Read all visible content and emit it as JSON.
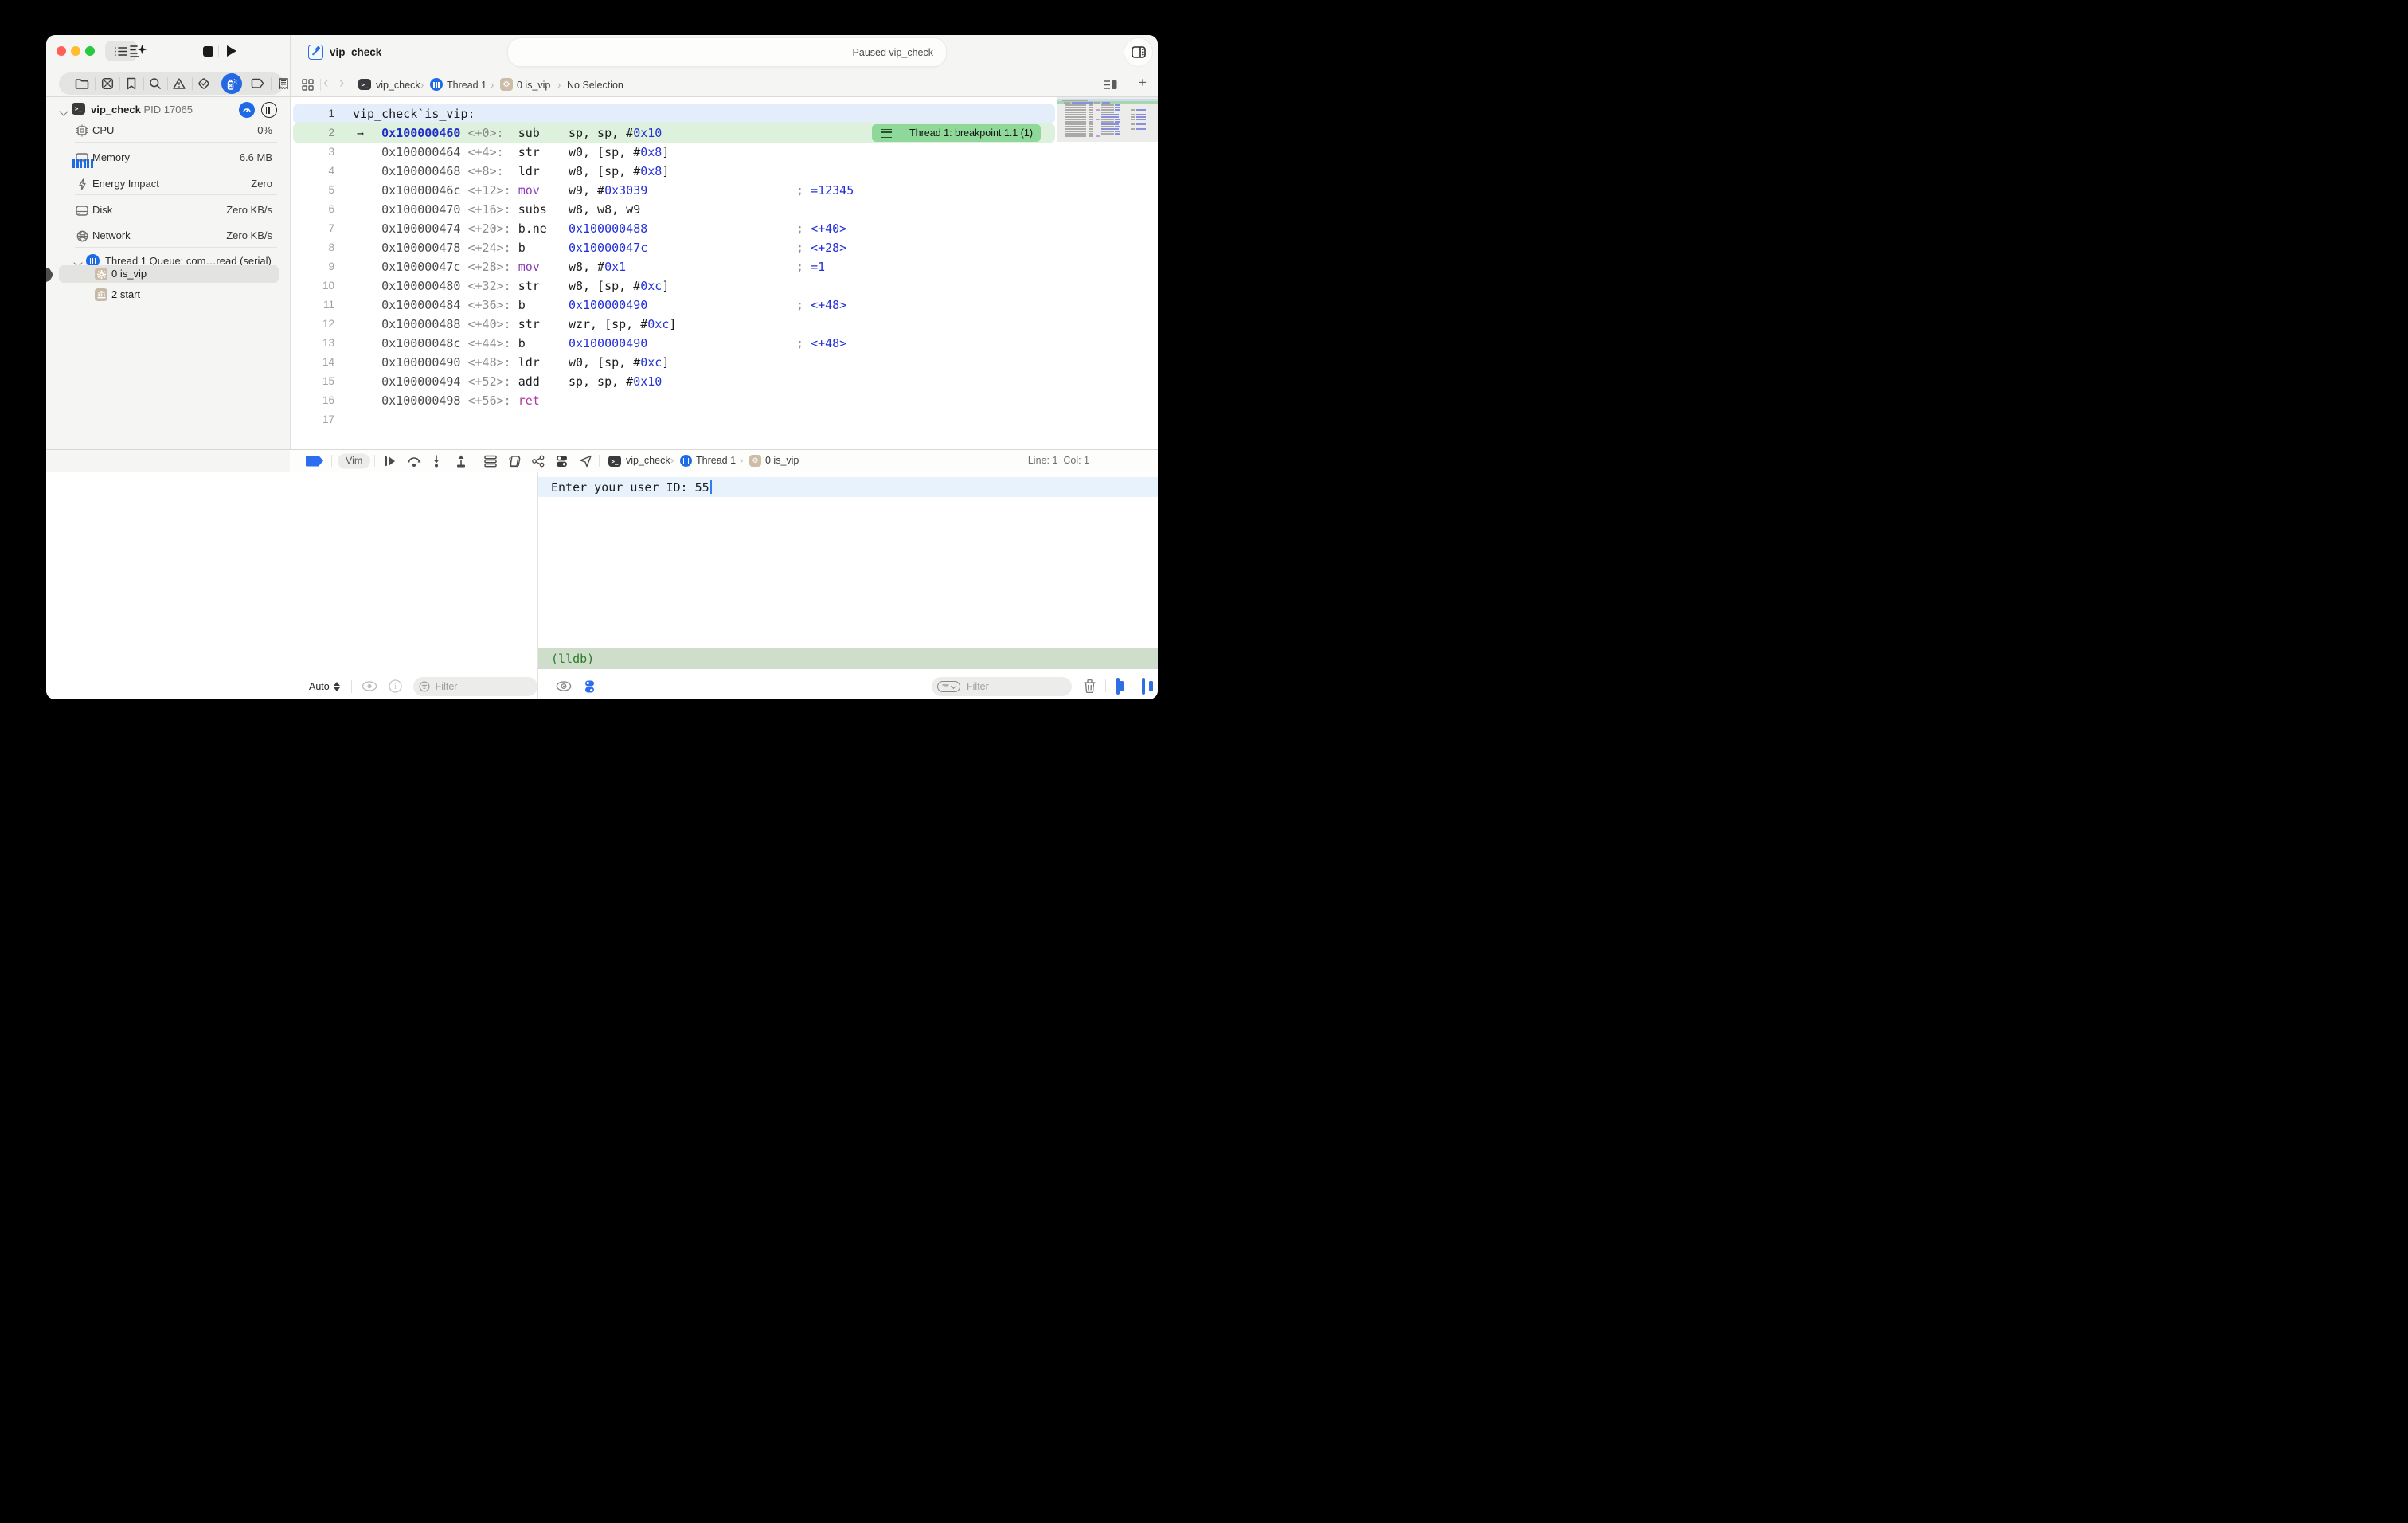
{
  "window": {
    "activity_status": "Paused vip_check",
    "tab": {
      "label": "vip_check"
    }
  },
  "sidebar": {
    "process": {
      "name": "vip_check",
      "pid": "PID 17065"
    },
    "stats": [
      {
        "label": "CPU",
        "value": "0%"
      },
      {
        "label": "Memory",
        "value": "6.6 MB"
      },
      {
        "label": "Energy Impact",
        "value": "Zero"
      },
      {
        "label": "Disk",
        "value": "Zero KB/s"
      },
      {
        "label": "Network",
        "value": "Zero KB/s"
      }
    ],
    "thread": {
      "label": "Thread 1 Queue: com…read (serial)"
    },
    "frames": [
      {
        "label": "0 is_vip",
        "icon": "gear-icon",
        "selected": true
      },
      {
        "label": "2 start",
        "icon": "bank-icon",
        "selected": false
      }
    ],
    "filter": {
      "placeholder": "Filter"
    }
  },
  "jumpbar": {
    "crumbs": [
      {
        "label": "vip_check",
        "icon": "terminal-icon"
      },
      {
        "label": "Thread 1",
        "icon": "thread-icon"
      },
      {
        "label": "0 is_vip",
        "icon": "gear-icon"
      },
      {
        "label": "No Selection",
        "icon": null
      }
    ]
  },
  "editor": {
    "breakpoint_badge": "Thread 1: breakpoint 1.1 (1)",
    "lines": [
      {
        "no": 1,
        "label": "vip_check`is_vip:"
      },
      {
        "no": 2,
        "current": true,
        "addr": "0x100000460",
        "off": "<+0>:",
        "mn": "sub",
        "ops": [
          [
            "k",
            "sp, sp, #"
          ],
          [
            "b",
            "0x10"
          ]
        ]
      },
      {
        "no": 3,
        "addr": "0x100000464",
        "off": "<+4>:",
        "mn": "str",
        "ops": [
          [
            "k",
            "w0, [sp, #"
          ],
          [
            "b",
            "0x8"
          ],
          [
            "k",
            "]"
          ]
        ]
      },
      {
        "no": 4,
        "addr": "0x100000468",
        "off": "<+8>:",
        "mn": "ldr",
        "ops": [
          [
            "k",
            "w8, [sp, #"
          ],
          [
            "b",
            "0x8"
          ],
          [
            "k",
            "]"
          ]
        ]
      },
      {
        "no": 5,
        "addr": "0x10000046c",
        "off": "<+12>:",
        "mn": "mov",
        "mnc": "p",
        "ops": [
          [
            "k",
            "w9, #"
          ],
          [
            "b",
            "0x3039"
          ]
        ],
        "cmt": [
          [
            "g",
            "; "
          ],
          [
            "b",
            "=12345"
          ]
        ]
      },
      {
        "no": 6,
        "addr": "0x100000470",
        "off": "<+16>:",
        "mn": "subs",
        "ops": [
          [
            "k",
            "w8, w8, w9"
          ]
        ]
      },
      {
        "no": 7,
        "addr": "0x100000474",
        "off": "<+20>:",
        "mn": "b.ne",
        "ops": [
          [
            "b",
            "0x100000488"
          ]
        ],
        "cmt": [
          [
            "g",
            "; "
          ],
          [
            "b",
            "<+40>"
          ]
        ]
      },
      {
        "no": 8,
        "addr": "0x100000478",
        "off": "<+24>:",
        "mn": "b",
        "ops": [
          [
            "b",
            "0x10000047c"
          ]
        ],
        "cmt": [
          [
            "g",
            "; "
          ],
          [
            "b",
            "<+28>"
          ]
        ]
      },
      {
        "no": 9,
        "addr": "0x10000047c",
        "off": "<+28>:",
        "mn": "mov",
        "mnc": "p",
        "ops": [
          [
            "k",
            "w8, #"
          ],
          [
            "b",
            "0x1"
          ]
        ],
        "cmt": [
          [
            "g",
            "; "
          ],
          [
            "b",
            "=1"
          ]
        ]
      },
      {
        "no": 10,
        "addr": "0x100000480",
        "off": "<+32>:",
        "mn": "str",
        "ops": [
          [
            "k",
            "w8, [sp, #"
          ],
          [
            "b",
            "0xc"
          ],
          [
            "k",
            "]"
          ]
        ]
      },
      {
        "no": 11,
        "addr": "0x100000484",
        "off": "<+36>:",
        "mn": "b",
        "ops": [
          [
            "b",
            "0x100000490"
          ]
        ],
        "cmt": [
          [
            "g",
            "; "
          ],
          [
            "b",
            "<+48>"
          ]
        ]
      },
      {
        "no": 12,
        "addr": "0x100000488",
        "off": "<+40>:",
        "mn": "str",
        "ops": [
          [
            "k",
            "wzr, [sp, #"
          ],
          [
            "b",
            "0xc"
          ],
          [
            "k",
            "]"
          ]
        ]
      },
      {
        "no": 13,
        "addr": "0x10000048c",
        "off": "<+44>:",
        "mn": "b",
        "ops": [
          [
            "b",
            "0x100000490"
          ]
        ],
        "cmt": [
          [
            "g",
            "; "
          ],
          [
            "b",
            "<+48>"
          ]
        ]
      },
      {
        "no": 14,
        "addr": "0x100000490",
        "off": "<+48>:",
        "mn": "ldr",
        "ops": [
          [
            "k",
            "w0, [sp, #"
          ],
          [
            "b",
            "0xc"
          ],
          [
            "k",
            "]"
          ]
        ]
      },
      {
        "no": 15,
        "addr": "0x100000494",
        "off": "<+52>:",
        "mn": "add",
        "ops": [
          [
            "k",
            "sp, sp, #"
          ],
          [
            "b",
            "0x10"
          ]
        ]
      },
      {
        "no": 16,
        "addr": "0x100000498",
        "off": "<+56>:",
        "mn": "ret",
        "mnc": "m",
        "ops": []
      },
      {
        "no": 17
      }
    ]
  },
  "debugbar": {
    "vim_badge": "Vim",
    "crumbs": [
      {
        "label": "vip_check",
        "icon": "terminal-icon"
      },
      {
        "label": "Thread 1",
        "icon": "thread-icon"
      },
      {
        "label": "0 is_vip",
        "icon": "gear-icon"
      }
    ],
    "line_col": "Line: 1  Col: 1"
  },
  "variables": {
    "scope": "Auto",
    "filter": {
      "placeholder": "Filter"
    }
  },
  "console": {
    "output": "Enter your user ID: 55",
    "prompt": "(lldb)",
    "filter": {
      "placeholder": "Filter"
    }
  },
  "colors": {
    "accent_blue": "#2a6df0",
    "k": "#1c1c1e",
    "b": "#2330d8",
    "g": "#8c8c8c",
    "p": "#8a3db6",
    "m": "#b03a96",
    "addr": "#4a4a4c",
    "off": "#8c8c8c",
    "addr_current": "#1f2ccc",
    "current_line_bg": "#def1dd",
    "selected_line_bg": "#e4eefb",
    "badge_green": "#8ed89a",
    "lldb_band": "#cfdeca",
    "lldb_text": "#2c7a2c",
    "console_row_bg": "#e8f2fd",
    "mini_gray": "#a9a9a9",
    "mini_indigo": "#8a8fdb",
    "mini_purple": "#c49fd3"
  }
}
